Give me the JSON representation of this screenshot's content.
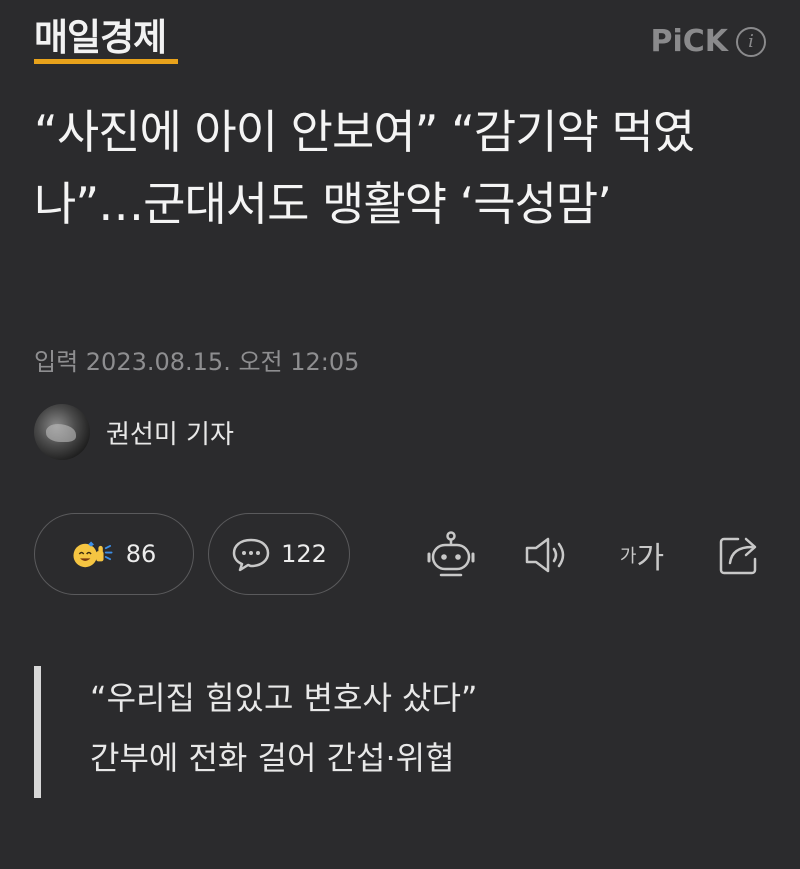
{
  "header": {
    "logo": "매일경제",
    "pick_label": "PiCK",
    "info_icon": "info-icon"
  },
  "article": {
    "headline": "“사진에 아이 안보여” “감기약 먹였나”…군대서도 맹활약 ‘극성맘’",
    "published": "입력 2023.08.15. 오전 12:05",
    "reporter": "권선미 기자"
  },
  "actions": {
    "like_count": "86",
    "comment_count": "122",
    "font_size_small": "가",
    "font_size_large": "가"
  },
  "subheadline": {
    "line1": "“우리집 힘있고 변호사 샀다”",
    "line2": "간부에 전화 걸어 간섭·위협"
  },
  "colors": {
    "background": "#2b2b2d",
    "logo_underline": "#e8a21b",
    "emoji_yellow": "#f5c542",
    "emoji_blue": "#3b8ee8"
  }
}
